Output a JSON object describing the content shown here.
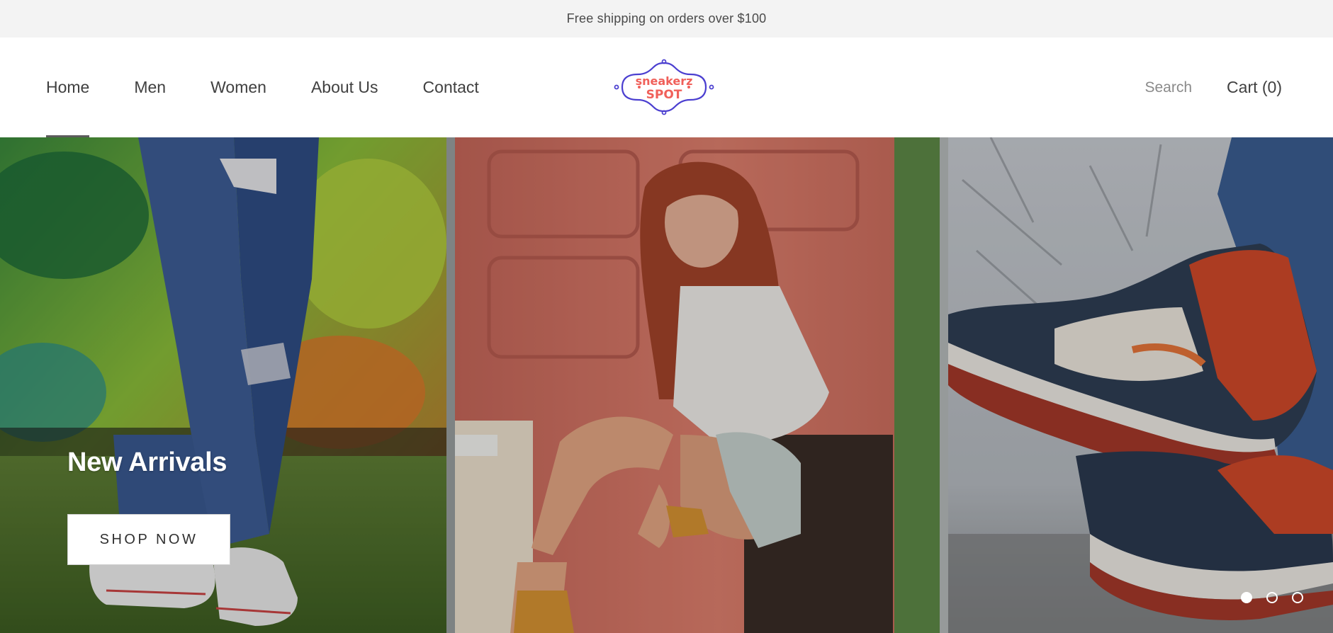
{
  "announcement": {
    "text": "Free shipping on orders over $100"
  },
  "nav": {
    "items": [
      {
        "label": "Home",
        "active": true
      },
      {
        "label": "Men",
        "active": false
      },
      {
        "label": "Women",
        "active": false
      },
      {
        "label": "About Us",
        "active": false
      },
      {
        "label": "Contact",
        "active": false
      }
    ]
  },
  "logo": {
    "line1": "sneakerz",
    "line2": "SPOT",
    "frame_color": "#4b3fd0",
    "text_color": "#f0605a"
  },
  "header_actions": {
    "search_label": "Search",
    "cart_label": "Cart (0)"
  },
  "hero": {
    "heading": "New Arrivals",
    "cta_label": "SHOP NOW",
    "slides": {
      "count": 3,
      "active_index": 0
    }
  }
}
